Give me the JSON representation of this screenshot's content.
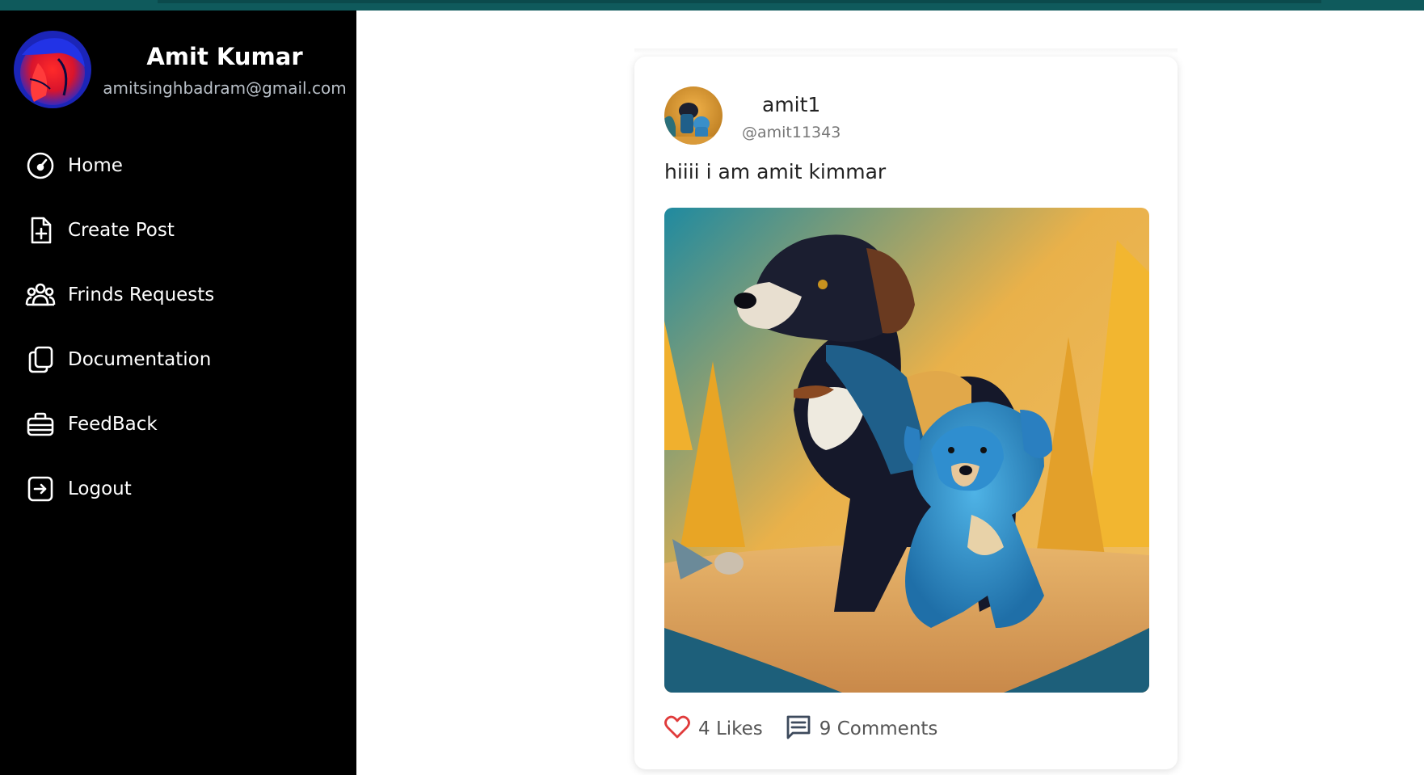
{
  "sidebar": {
    "profile": {
      "name": "Amit Kumar",
      "email": "amitsinghbadram@gmail.com"
    },
    "items": [
      {
        "label": "Home",
        "icon": "dashboard-gauge-icon"
      },
      {
        "label": "Create Post",
        "icon": "file-plus-icon"
      },
      {
        "label": "Frinds Requests",
        "icon": "users-group-icon"
      },
      {
        "label": "Documentation",
        "icon": "copy-documents-icon"
      },
      {
        "label": "FeedBack",
        "icon": "briefcase-icon"
      },
      {
        "label": "Logout",
        "icon": "logout-arrow-icon"
      }
    ]
  },
  "post": {
    "username": "amit1",
    "handle": "@amit11343",
    "text": "hiiii i am amit kimmar",
    "likes_label": "4 Likes",
    "comments_label": "9 Comments"
  },
  "colors": {
    "topbar": "#0f5a5c",
    "sidebar_bg": "#000000",
    "like_icon": "#e03b3b",
    "comment_icon": "#3d4a5c"
  }
}
